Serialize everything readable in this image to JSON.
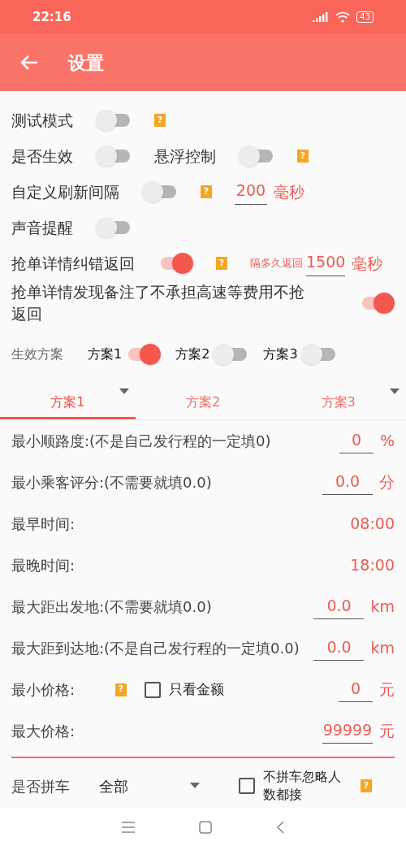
{
  "status_bar": {
    "time": "22:16",
    "battery": "43"
  },
  "header": {
    "title": "设置"
  },
  "settings": [
    {
      "items": [
        {
          "kind": "label",
          "text": "测试模式"
        },
        {
          "kind": "toggle",
          "on": false
        },
        {
          "kind": "help",
          "text": "?"
        }
      ]
    },
    {
      "items": [
        {
          "kind": "label",
          "text": "是否生效"
        },
        {
          "kind": "toggle",
          "on": false
        },
        {
          "kind": "label",
          "text": "悬浮控制"
        },
        {
          "kind": "toggle",
          "on": false
        },
        {
          "kind": "help",
          "text": "?"
        }
      ]
    },
    {
      "items": [
        {
          "kind": "label",
          "text": "自定义刷新间隔"
        },
        {
          "kind": "toggle",
          "on": false
        },
        {
          "kind": "help",
          "text": "?"
        },
        {
          "kind": "field",
          "value": "200",
          "unit": "毫秒"
        }
      ]
    },
    {
      "items": [
        {
          "kind": "label",
          "text": "声音提醒"
        },
        {
          "kind": "toggle",
          "on": false
        }
      ]
    },
    {
      "items": [
        {
          "kind": "label",
          "text": "抢单详情纠错返回"
        },
        {
          "kind": "toggle",
          "on": true
        },
        {
          "kind": "help",
          "text": "?"
        },
        {
          "kind": "note",
          "text": "隔多久返回"
        },
        {
          "kind": "field",
          "value": "1500",
          "unit": "毫秒"
        }
      ]
    },
    {
      "items": [
        {
          "kind": "longlabel",
          "text": "抢单详情发现备注了不承担高速等费用不抢返回"
        },
        {
          "kind": "toggle",
          "on": true
        }
      ]
    }
  ],
  "schemes": {
    "label": "生效方案",
    "options": [
      {
        "label": "方案1",
        "on": true
      },
      {
        "label": "方案2",
        "on": false
      },
      {
        "label": "方案3",
        "on": false
      }
    ]
  },
  "tabs": [
    {
      "label": "方案1",
      "selected": true,
      "menu": true
    },
    {
      "label": "方案2",
      "selected": false,
      "menu": false
    },
    {
      "label": "方案3",
      "selected": false,
      "menu": true
    }
  ],
  "form": [
    {
      "kind": "field",
      "label": "最小顺路度:(不是自己发行程的一定填0)",
      "value": "0",
      "unit": "%"
    },
    {
      "kind": "field",
      "label": "最小乘客评分:(不需要就填0.0)",
      "value": "0.0",
      "unit": "分"
    },
    {
      "kind": "time",
      "label": "最早时间:",
      "value": "08:00"
    },
    {
      "kind": "time",
      "label": "最晚时间:",
      "value": "18:00"
    },
    {
      "kind": "field",
      "label": "最大距出发地:(不需要就填0.0)",
      "value": "0.0",
      "unit": "km"
    },
    {
      "kind": "field",
      "label": "最大距到达地:(不是自己发行程的一定填0.0)",
      "value": "0.0",
      "unit": "km"
    },
    {
      "kind": "price",
      "label": "最小价格:",
      "help": "?",
      "checkbox": {
        "label": "只看金额",
        "checked": false
      },
      "value": "0",
      "unit": "元"
    },
    {
      "kind": "field",
      "label": "最大价格:",
      "value": "99999",
      "unit": "元"
    }
  ],
  "carpool": {
    "label": "是否拼车",
    "select": "全部",
    "checkbox": {
      "label": "不拼车忽略人数都接",
      "checked": false
    },
    "help": "?"
  }
}
